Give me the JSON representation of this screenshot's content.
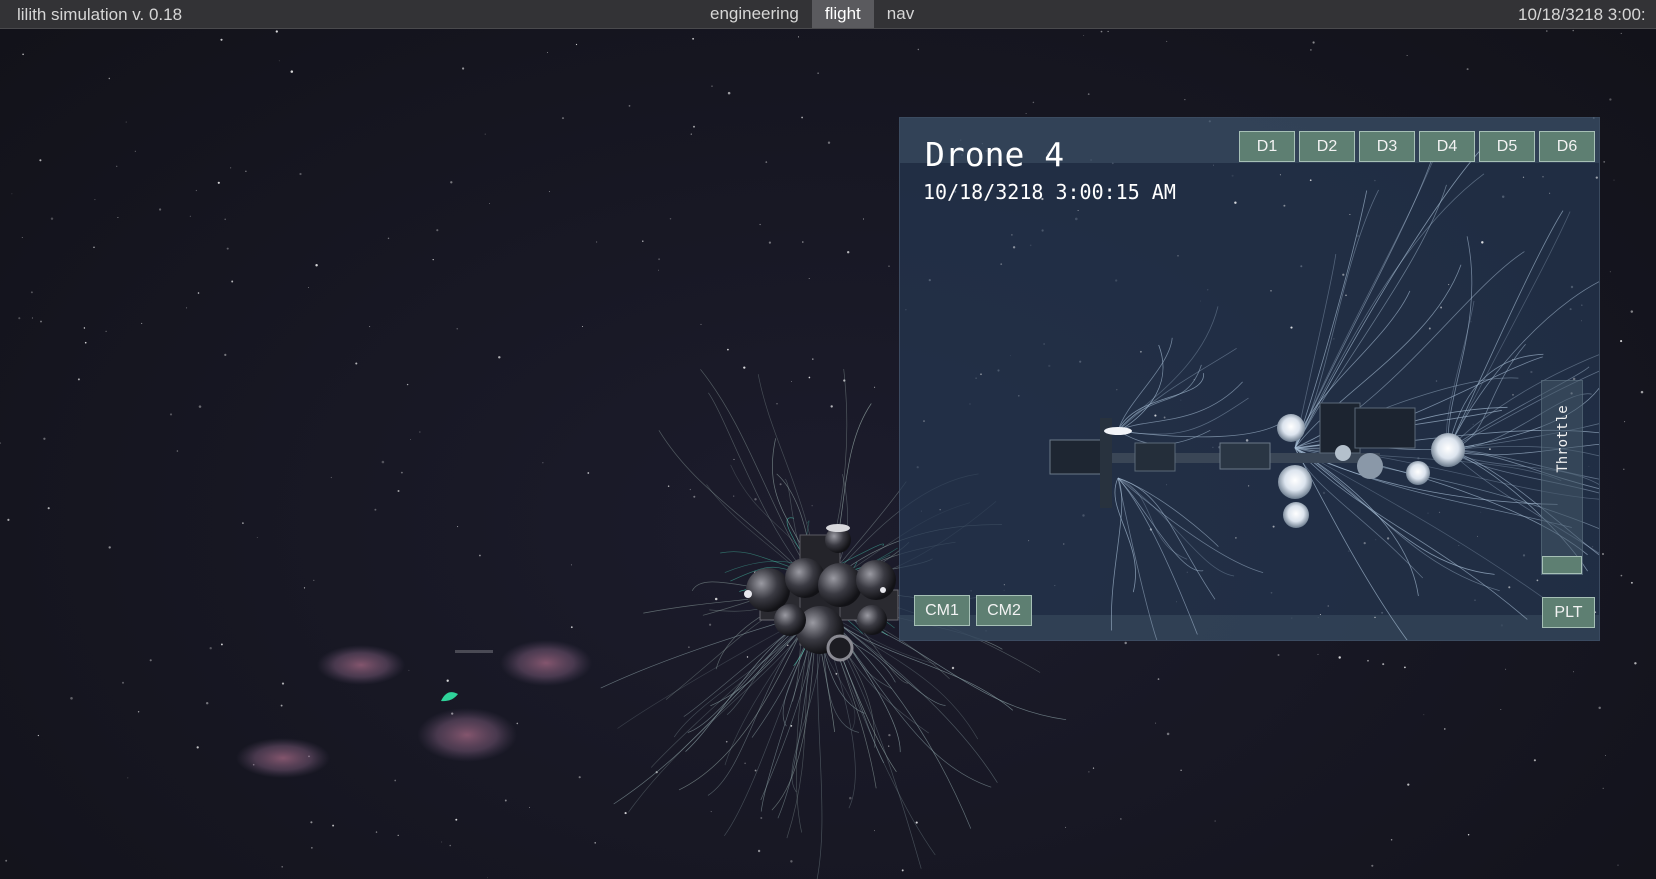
{
  "app": {
    "title": "lilith simulation v. 0.18",
    "clock": "10/18/3218 3:00:"
  },
  "tabs": [
    {
      "label": "engineering",
      "active": false
    },
    {
      "label": "flight",
      "active": true
    },
    {
      "label": "nav",
      "active": false
    }
  ],
  "drone_panel": {
    "title": "Drone 4",
    "timestamp": "10/18/3218 3:00:15 AM",
    "drone_tabs": [
      "D1",
      "D2",
      "D3",
      "D4",
      "D5",
      "D6"
    ],
    "selected_drone": "D4",
    "cm_buttons": [
      "CM1",
      "CM2"
    ],
    "plt_label": "PLT",
    "throttle_label": "Throttle",
    "throttle_level": 0.08
  },
  "colors": {
    "space": "#161624",
    "topbar": "#333336",
    "active_tab": "#5a5a5e",
    "button": "#5e7f72",
    "button_border": "#a6c0b6",
    "panel": "#263852",
    "tether": "#7fd6c4"
  },
  "icons": {
    "tether": "particle-tether-strand",
    "ship": "mothership-model",
    "drone": "drone-model"
  }
}
